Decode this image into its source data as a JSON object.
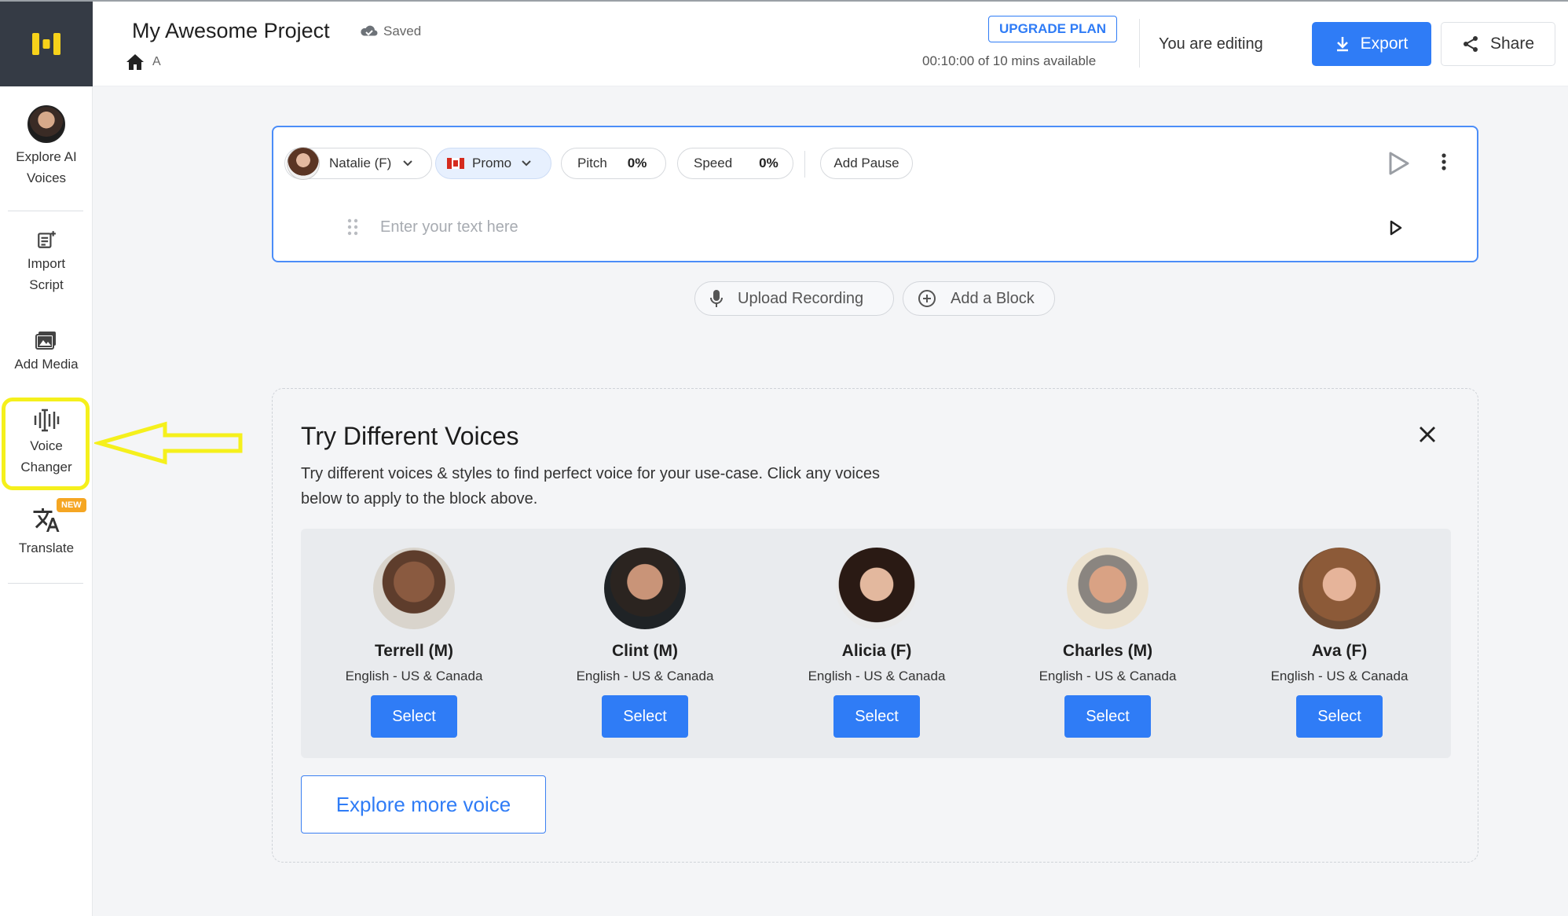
{
  "colors": {
    "accent": "#2f7cf6",
    "highlight": "#f5f01c",
    "sidebar_logo_bg": "#353b45",
    "new_badge": "#f5a623"
  },
  "sidebar": {
    "logo_icon": "app-logo-icon",
    "items": [
      {
        "label_1": "Explore AI",
        "label_2": "Voices",
        "icon": "avatar"
      },
      {
        "label_1": "Import",
        "label_2": "Script",
        "icon": "import-script-icon"
      },
      {
        "label_1": "Add Media",
        "icon": "media-icon"
      },
      {
        "label_1": "Voice",
        "label_2": "Changer",
        "icon": "voice-changer-icon"
      },
      {
        "label_1": "Translate",
        "icon": "translate-icon",
        "badge": "NEW"
      }
    ]
  },
  "header": {
    "project_title": "My Awesome Project",
    "saved_status": "Saved",
    "breadcrumb_label": "A",
    "upgrade_label": "UPGRADE PLAN",
    "minutes_available": "00:10:00 of 10 mins available",
    "editing_status": "You are editing",
    "export_label": "Export",
    "share_label": "Share"
  },
  "editor": {
    "voice_name": "Natalie (F)",
    "style_label": "Promo",
    "pitch_label": "Pitch",
    "pitch_value": "0%",
    "speed_label": "Speed",
    "speed_value": "0%",
    "add_pause_label": "Add Pause",
    "text_placeholder": "Enter your text here"
  },
  "actions": {
    "upload_recording": "Upload Recording",
    "add_block": "Add a Block"
  },
  "voices_panel": {
    "title": "Try Different Voices",
    "description": "Try different voices & styles to find perfect voice for your use-case. Click any voices below to apply to the block above.",
    "voices": [
      {
        "name": "Terrell (M)",
        "language": "English - US & Canada",
        "select_label": "Select"
      },
      {
        "name": "Clint (M)",
        "language": "English - US & Canada",
        "select_label": "Select"
      },
      {
        "name": "Alicia (F)",
        "language": "English - US & Canada",
        "select_label": "Select"
      },
      {
        "name": "Charles (M)",
        "language": "English - US & Canada",
        "select_label": "Select"
      },
      {
        "name": "Ava (F)",
        "language": "English - US & Canada",
        "select_label": "Select"
      }
    ],
    "explore_more_label": "Explore more voice"
  }
}
